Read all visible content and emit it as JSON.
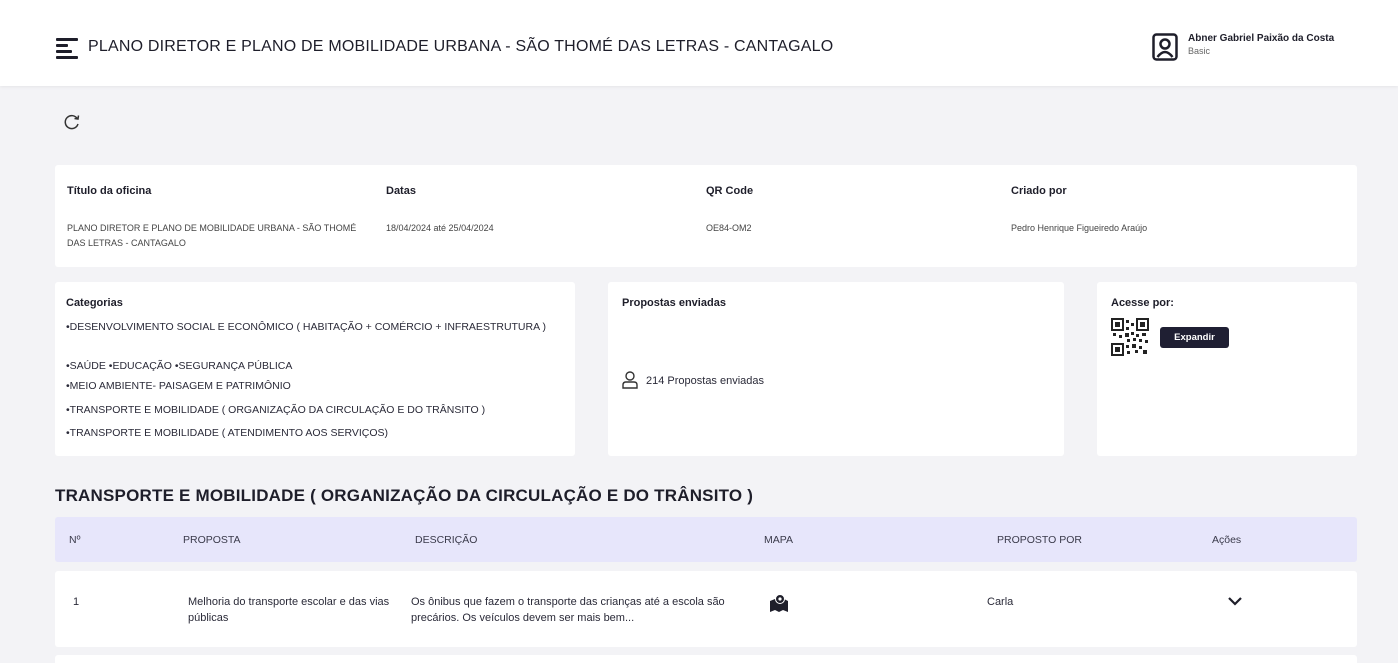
{
  "header": {
    "title": "PLANO DIRETOR E PLANO DE MOBILIDADE URBANA - SÃO THOMÉ DAS LETRAS - CANTAGALO",
    "user_name": "Abner Gabriel Paixão da Costa",
    "user_plan": "Basic",
    "menu_icon": "menu-icon",
    "user_icon": "user-icon"
  },
  "toolbar": {
    "refresh_icon": "refresh-icon"
  },
  "info": {
    "title_label": "Título da oficina",
    "title_value": "PLANO DIRETOR E PLANO DE MOBILIDADE URBANA - SÃO THOMÉ DAS LETRAS - CANTAGALO",
    "dates_label": "Datas",
    "dates_value": "18/04/2024 até 25/04/2024",
    "qr_label": "QR Code",
    "qr_value": "OE84-OM2",
    "creator_label": "Criado por",
    "creator_value": "Pedro Henrique Figueiredo Araújo"
  },
  "categories": {
    "label": "Categorias",
    "items": [
      "•DESENVOLVIMENTO SOCIAL E ECONÔMICO ( HABITAÇÃO + COMÉRCIO + INFRAESTRUTURA )",
      "•SAÚDE •EDUCAÇÃO •SEGURANÇA PÚBLICA",
      "•MEIO AMBIENTE- PAISAGEM E PATRIMÔNIO",
      "•TRANSPORTE E MOBILIDADE ( ORGANIZAÇÃO DA CIRCULAÇÃO E DO TRÂNSITO )",
      "•TRANSPORTE E MOBILIDADE ( ATENDIMENTO AOS SERVIÇOS)"
    ]
  },
  "proposals": {
    "label": "Propostas enviadas",
    "count_text": "214 Propostas enviadas",
    "icon": "user-icon"
  },
  "access": {
    "label": "Acesse por:",
    "expand_label": "Expandir",
    "qr_icon": "qr-code-icon"
  },
  "section": {
    "title": "TRANSPORTE E MOBILIDADE ( ORGANIZAÇÃO DA CIRCULAÇÃO E DO TRÂNSITO )"
  },
  "table": {
    "headers": [
      "Nº",
      "PROPOSTA",
      "DESCRIÇÃO",
      "MAPA",
      "PROPOSTO POR",
      "Ações"
    ],
    "rows": [
      {
        "num": "1",
        "proposal": "Melhoria do transporte escolar e das vias públicas",
        "description": "Os ônibus que fazem o transporte das crianças até a escola são precários. Os veículos devem ser mais bem...",
        "map_icon": "map-icon",
        "author": "Carla",
        "action_icon": "chevron-down-icon"
      }
    ]
  },
  "colors": {
    "accent": "#1f1f33",
    "table_header_bg": "#e7e6fb",
    "page_bg": "#f3f3f6"
  }
}
